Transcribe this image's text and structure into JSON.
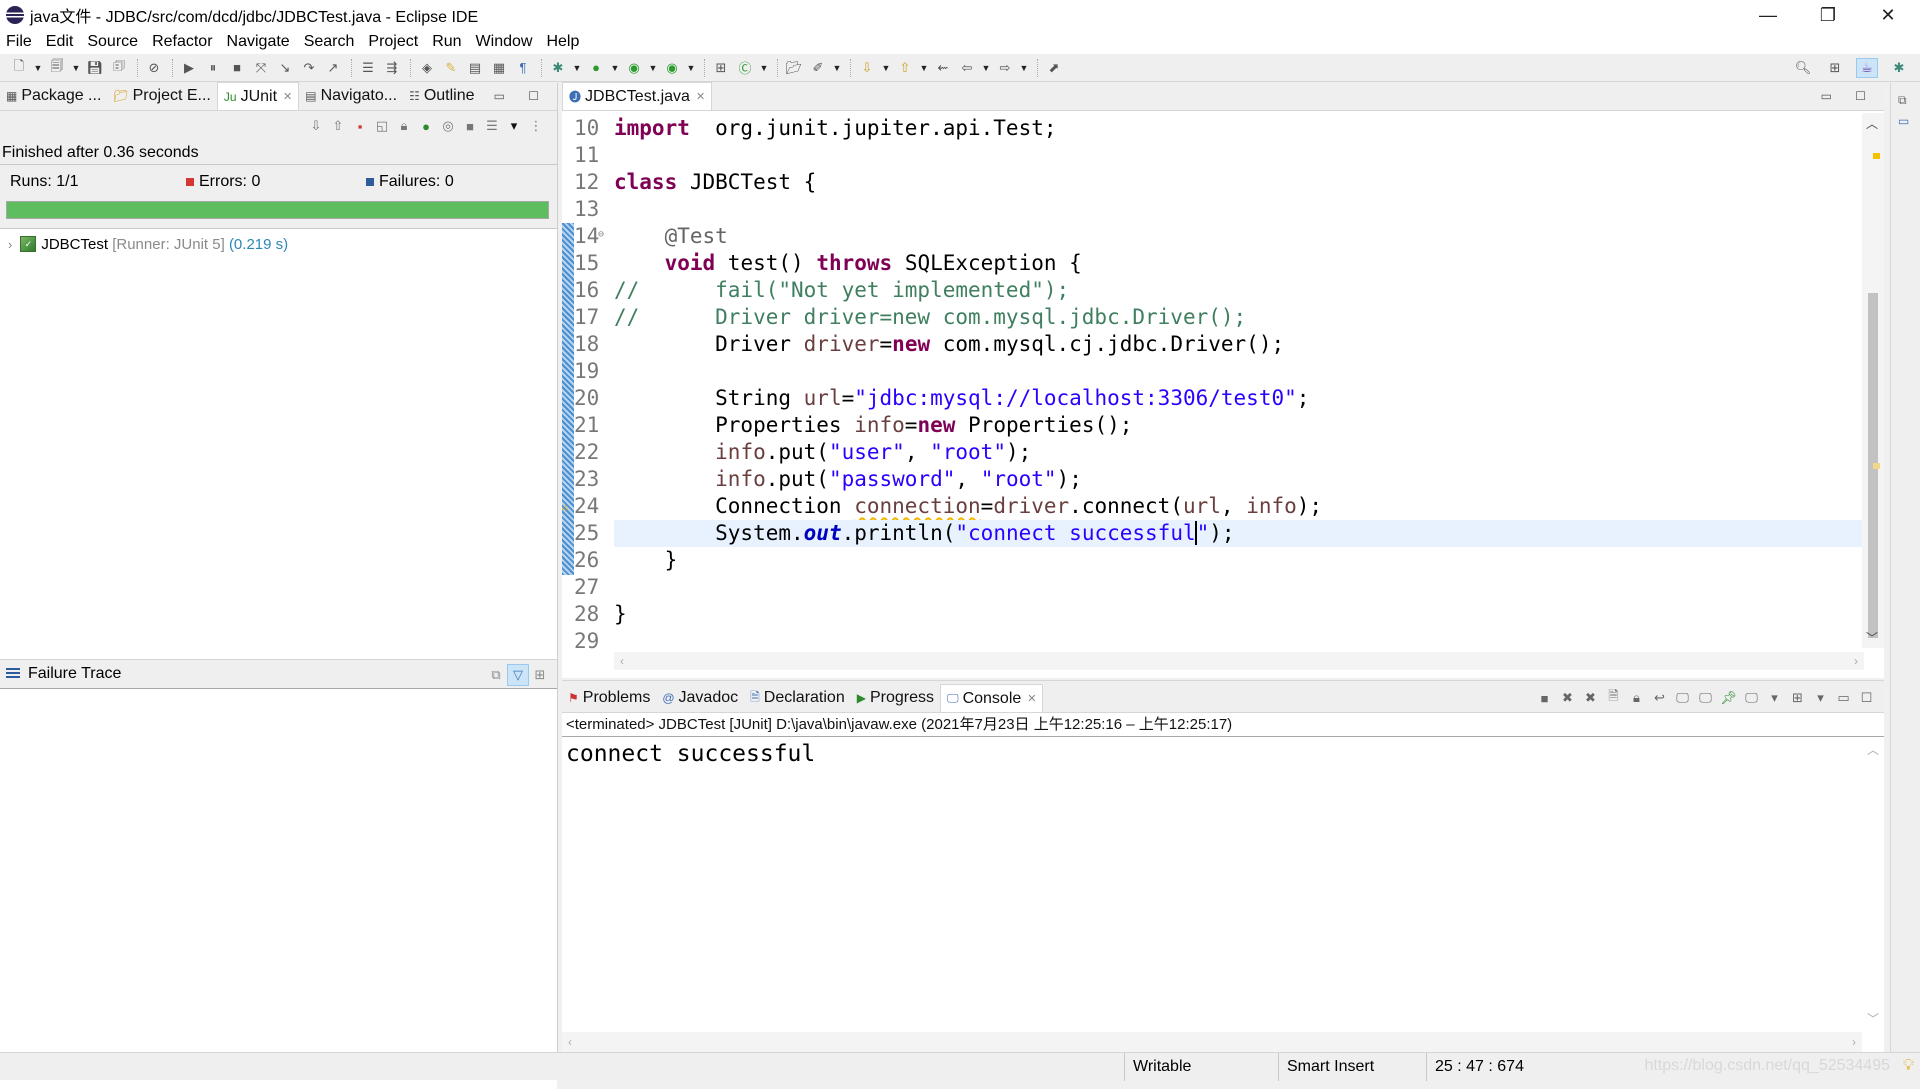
{
  "window": {
    "title": "java文件 - JDBC/src/com/dcd/jdbc/JDBCTest.java - Eclipse IDE",
    "minimize": "—",
    "restore": "❐",
    "close": "✕"
  },
  "menubar": [
    "File",
    "Edit",
    "Source",
    "Refactor",
    "Navigate",
    "Search",
    "Project",
    "Run",
    "Window",
    "Help"
  ],
  "toolbar": {
    "icons": [
      "new-icon",
      "dropdown",
      "new-file-icon",
      "dropdown",
      "save-icon",
      "save-all-icon",
      "sep",
      "skip-breakpoints-icon",
      "sep",
      "resume-icon",
      "suspend-icon",
      "terminate-icon",
      "disconnect-icon",
      "step-into-icon",
      "step-over-icon",
      "step-return-icon",
      "sep",
      "drop-to-frame-icon",
      "use-step-filters-icon",
      "sep",
      "open-type-icon",
      "mark-occurrences-icon",
      "toggle-block-icon",
      "word-wrap-icon",
      "show-whitespace-icon",
      "sep",
      "debug-icon",
      "dropdown",
      "run-icon",
      "dropdown",
      "coverage-icon",
      "dropdown",
      "external-tools-icon",
      "dropdown",
      "sep",
      "new-java-package-icon",
      "new-class-icon",
      "dropdown",
      "sep",
      "open-task-icon",
      "search-icon-pen",
      "dropdown",
      "sep",
      "next-annotation-icon",
      "dropdown",
      "prev-annotation-icon",
      "dropdown",
      "last-edit-icon",
      "back-icon",
      "dropdown",
      "forward-icon",
      "dropdown",
      "sep",
      "pin-icon"
    ],
    "right_icons": [
      "search-icon",
      "open-perspective-icon",
      "java-perspective-icon",
      "debug-perspective-icon"
    ]
  },
  "left_panel": {
    "tabs": [
      {
        "label": "Package ...",
        "icon": "package-explorer-icon",
        "active": false
      },
      {
        "label": "Project E...",
        "icon": "project-explorer-icon",
        "active": false
      },
      {
        "label": "JUnit",
        "icon": "junit-icon",
        "active": true,
        "closable": true
      },
      {
        "label": "Navigato...",
        "icon": "navigator-icon",
        "active": false
      },
      {
        "label": "Outline",
        "icon": "outline-icon",
        "active": false
      }
    ],
    "junit": {
      "status": "Finished after 0.36 seconds",
      "runs_label": "Runs:",
      "runs_value": "1/1",
      "errors_label": "Errors:",
      "errors_value": "0",
      "failures_label": "Failures:",
      "failures_value": "0",
      "progress": 1.0,
      "progress_color": "#5ebd5e",
      "tree": [
        {
          "name": "JDBCTest",
          "runner": "[Runner: JUnit 5]",
          "time": "(0.219 s)"
        }
      ],
      "failure_trace_title": "Failure Trace"
    }
  },
  "editor": {
    "tab_label": "JDBCTest.java",
    "lines": [
      {
        "n": "10",
        "tokens": [
          [
            "kw",
            "import"
          ],
          [
            "",
            "  org.junit.jupiter.api.Test;"
          ]
        ]
      },
      {
        "n": "11",
        "tokens": []
      },
      {
        "n": "12",
        "tokens": [
          [
            "kw",
            "class"
          ],
          [
            "",
            " JDBCTest {"
          ]
        ]
      },
      {
        "n": "13",
        "tokens": []
      },
      {
        "n": "14",
        "tokens": [
          [
            "",
            "    "
          ],
          [
            "ann",
            "@Test"
          ]
        ]
      },
      {
        "n": "15",
        "tokens": [
          [
            "",
            "    "
          ],
          [
            "kw",
            "void"
          ],
          [
            "",
            " test() "
          ],
          [
            "kw",
            "throws"
          ],
          [
            "",
            " SQLException {"
          ]
        ]
      },
      {
        "n": "16",
        "tokens": [
          [
            "cm",
            "//      fail(\"Not yet implemented\");"
          ]
        ]
      },
      {
        "n": "17",
        "tokens": [
          [
            "cm",
            "//      Driver driver=new com.mysql.jdbc.Driver();"
          ]
        ]
      },
      {
        "n": "18",
        "tokens": [
          [
            "",
            "        Driver "
          ],
          [
            "var",
            "driver"
          ],
          [
            "",
            "="
          ],
          [
            "kw",
            "new"
          ],
          [
            "",
            " com.mysql.cj.jdbc.Driver();"
          ]
        ]
      },
      {
        "n": "19",
        "tokens": []
      },
      {
        "n": "20",
        "tokens": [
          [
            "",
            "        String "
          ],
          [
            "var",
            "url"
          ],
          [
            "",
            "="
          ],
          [
            "str",
            "\"jdbc:mysql://localhost:3306/test0\""
          ],
          [
            "",
            ";"
          ]
        ]
      },
      {
        "n": "21",
        "tokens": [
          [
            "",
            "        Properties "
          ],
          [
            "var",
            "info"
          ],
          [
            "",
            "="
          ],
          [
            "kw",
            "new"
          ],
          [
            "",
            " Properties();"
          ]
        ]
      },
      {
        "n": "22",
        "tokens": [
          [
            "",
            "        "
          ],
          [
            "var",
            "info"
          ],
          [
            "",
            ".put("
          ],
          [
            "str",
            "\"user\""
          ],
          [
            "",
            ", "
          ],
          [
            "str",
            "\"root\""
          ],
          [
            "",
            ");"
          ]
        ]
      },
      {
        "n": "23",
        "tokens": [
          [
            "",
            "        "
          ],
          [
            "var",
            "info"
          ],
          [
            "",
            ".put("
          ],
          [
            "str",
            "\"password\""
          ],
          [
            "",
            ", "
          ],
          [
            "str",
            "\"root\""
          ],
          [
            "",
            ");"
          ]
        ]
      },
      {
        "n": "24",
        "tokens": [
          [
            "",
            "        Connection "
          ],
          [
            "var warn",
            "connection"
          ],
          [
            "",
            "="
          ],
          [
            "var",
            "driver"
          ],
          [
            "",
            ".connect("
          ],
          [
            "var",
            "url"
          ],
          [
            "",
            ", "
          ],
          [
            "var",
            "info"
          ],
          [
            "",
            ");"
          ]
        ]
      },
      {
        "n": "25",
        "tokens": [
          [
            "",
            "        System."
          ],
          [
            "static",
            "out"
          ],
          [
            "",
            ".println("
          ],
          [
            "str",
            "\"connect successful"
          ],
          [
            "caret",
            ""
          ],
          [
            "str",
            "\""
          ],
          [
            "",
            ");"
          ]
        ],
        "current": true
      },
      {
        "n": "26",
        "tokens": [
          [
            "",
            "    }"
          ]
        ]
      },
      {
        "n": "27",
        "tokens": []
      },
      {
        "n": "28",
        "tokens": [
          [
            "",
            "}"
          ]
        ]
      },
      {
        "n": "29",
        "tokens": []
      }
    ]
  },
  "console_panel": {
    "tabs": [
      {
        "label": "Problems",
        "icon": "problems-icon"
      },
      {
        "label": "Javadoc",
        "icon": "javadoc-icon"
      },
      {
        "label": "Declaration",
        "icon": "declaration-icon"
      },
      {
        "label": "Progress",
        "icon": "progress-icon"
      },
      {
        "label": "Console",
        "icon": "console-icon",
        "active": true,
        "closable": true
      }
    ],
    "description": "<terminated> JDBCTest [JUnit] D:\\java\\bin\\javaw.exe  (2021年7月23日 上午12:25:16 – 上午12:25:17)",
    "output": "connect successful"
  },
  "statusbar": {
    "writable": "Writable",
    "insert_mode": "Smart Insert",
    "position": "25 : 47 : 674",
    "watermark": "https://blog.csdn.net/qq_52534495"
  }
}
